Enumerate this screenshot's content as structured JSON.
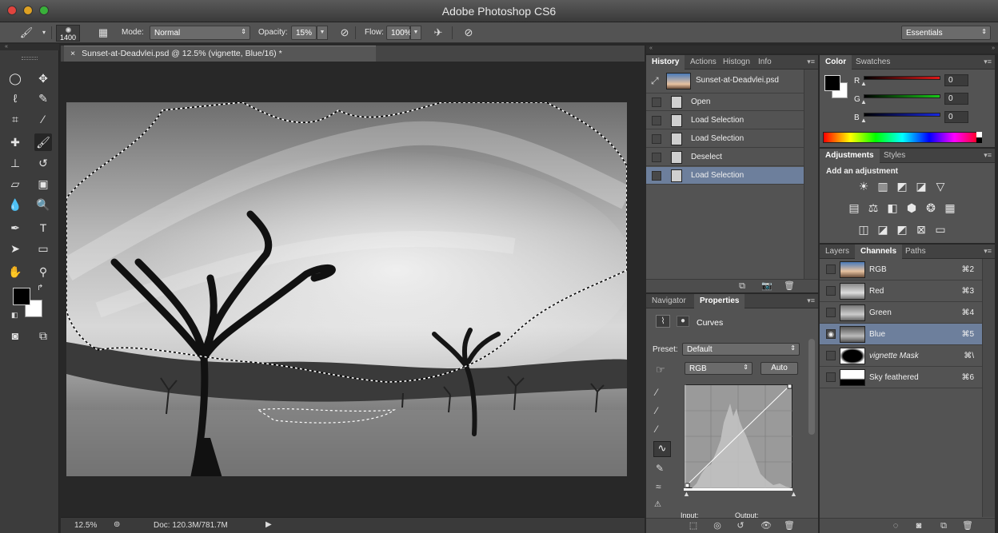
{
  "window": {
    "title": "Adobe Photoshop CS6"
  },
  "options_bar": {
    "brush_size": "1400",
    "mode_label": "Mode:",
    "mode_value": "Normal",
    "opacity_label": "Opacity:",
    "opacity_value": "15%",
    "flow_label": "Flow:",
    "flow_value": "100%",
    "workspace": "Essentials"
  },
  "document": {
    "tab_title": "Sunset-at-Deadvlei.psd @ 12.5% (vignette, Blue/16) *",
    "zoom": "12.5%",
    "doc_size": "Doc: 120.3M/781.7M"
  },
  "history_panel": {
    "tabs": [
      "History",
      "Actions",
      "Histogn",
      "Info"
    ],
    "snapshot": "Sunset-at-Deadvlei.psd",
    "items": [
      {
        "label": "Open",
        "selected": false
      },
      {
        "label": "Load Selection",
        "selected": false
      },
      {
        "label": "Load Selection",
        "selected": false
      },
      {
        "label": "Deselect",
        "selected": false
      },
      {
        "label": "Load Selection",
        "selected": true
      }
    ]
  },
  "color_panel": {
    "tabs": [
      "Color",
      "Swatches"
    ],
    "channels": [
      {
        "label": "R",
        "value": "0",
        "color": "#e01818"
      },
      {
        "label": "G",
        "value": "0",
        "color": "#18c818"
      },
      {
        "label": "B",
        "value": "0",
        "color": "#1828e0"
      }
    ]
  },
  "adjustments_panel": {
    "tabs": [
      "Adjustments",
      "Styles"
    ],
    "heading": "Add an adjustment"
  },
  "properties_panel": {
    "tabs": [
      "Navigator",
      "Properties"
    ],
    "title": "Curves",
    "preset_label": "Preset:",
    "preset_value": "Default",
    "channel_value": "RGB",
    "auto_label": "Auto",
    "input_label": "Input:",
    "output_label": "Output:"
  },
  "channels_panel": {
    "tabs": [
      "Layers",
      "Channels",
      "Paths"
    ],
    "items": [
      {
        "name": "RGB",
        "shortcut": "⌘2",
        "selected": false,
        "visible": false
      },
      {
        "name": "Red",
        "shortcut": "⌘3",
        "selected": false,
        "visible": false
      },
      {
        "name": "Green",
        "shortcut": "⌘4",
        "selected": false,
        "visible": false
      },
      {
        "name": "Blue",
        "shortcut": "⌘5",
        "selected": true,
        "visible": true
      },
      {
        "name": "vignette Mask",
        "shortcut": "⌘\\",
        "selected": false,
        "visible": false
      },
      {
        "name": "Sky feathered",
        "shortcut": "⌘6",
        "selected": false,
        "visible": false
      }
    ]
  }
}
